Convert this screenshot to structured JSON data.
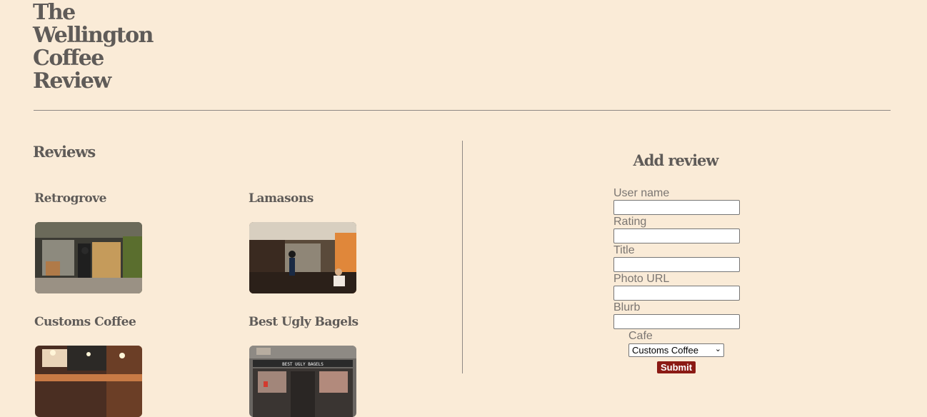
{
  "site": {
    "title_lines": [
      "The",
      "Wellington",
      "Coffee",
      "Review"
    ]
  },
  "reviews": {
    "heading": "Reviews",
    "cards": [
      {
        "name": "Retrogrove",
        "photo": "cafe-storefront-photo"
      },
      {
        "name": "Lamasons",
        "photo": "cafe-interior-photo"
      },
      {
        "name": "Customs Coffee",
        "photo": "cafe-counter-photo"
      },
      {
        "name": "Best Ugly Bagels",
        "photo": "bagel-shop-storefront-photo",
        "sign_text": "BEST UGLY BAGELS"
      }
    ]
  },
  "form": {
    "heading": "Add review",
    "fields": [
      {
        "label": "User name",
        "value": ""
      },
      {
        "label": "Rating",
        "value": ""
      },
      {
        "label": "Title",
        "value": ""
      },
      {
        "label": "Photo URL",
        "value": ""
      },
      {
        "label": "Blurb",
        "value": ""
      }
    ],
    "cafe_label": "Cafe",
    "cafe_selected": "Customs Coffee",
    "submit_label": "Submit"
  },
  "colors": {
    "background": "#faebd7",
    "text": "#5f5b58",
    "submit_button": "#8b1a14"
  }
}
